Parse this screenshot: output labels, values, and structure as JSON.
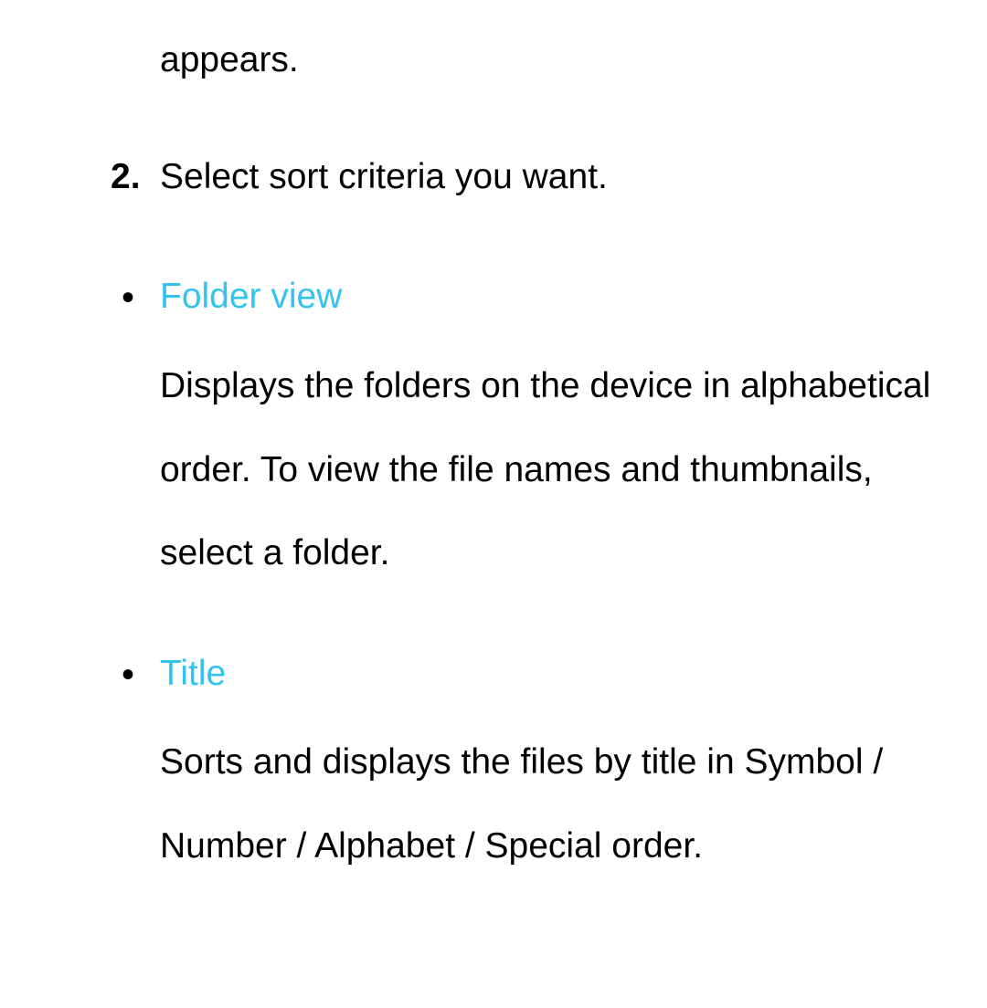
{
  "fragment_top": "appears.",
  "step2": {
    "marker": "2.",
    "text": "Select sort criteria you want."
  },
  "items": [
    {
      "title": "Folder view",
      "desc": "Displays the folders on the device in alphabetical order. To view the file names and thumbnails, select a folder."
    },
    {
      "title": "Title",
      "desc": "Sorts and displays the files by title in Symbol / Number / Alphabet / Special order."
    }
  ],
  "colors": {
    "accent": "#33c3f0"
  }
}
